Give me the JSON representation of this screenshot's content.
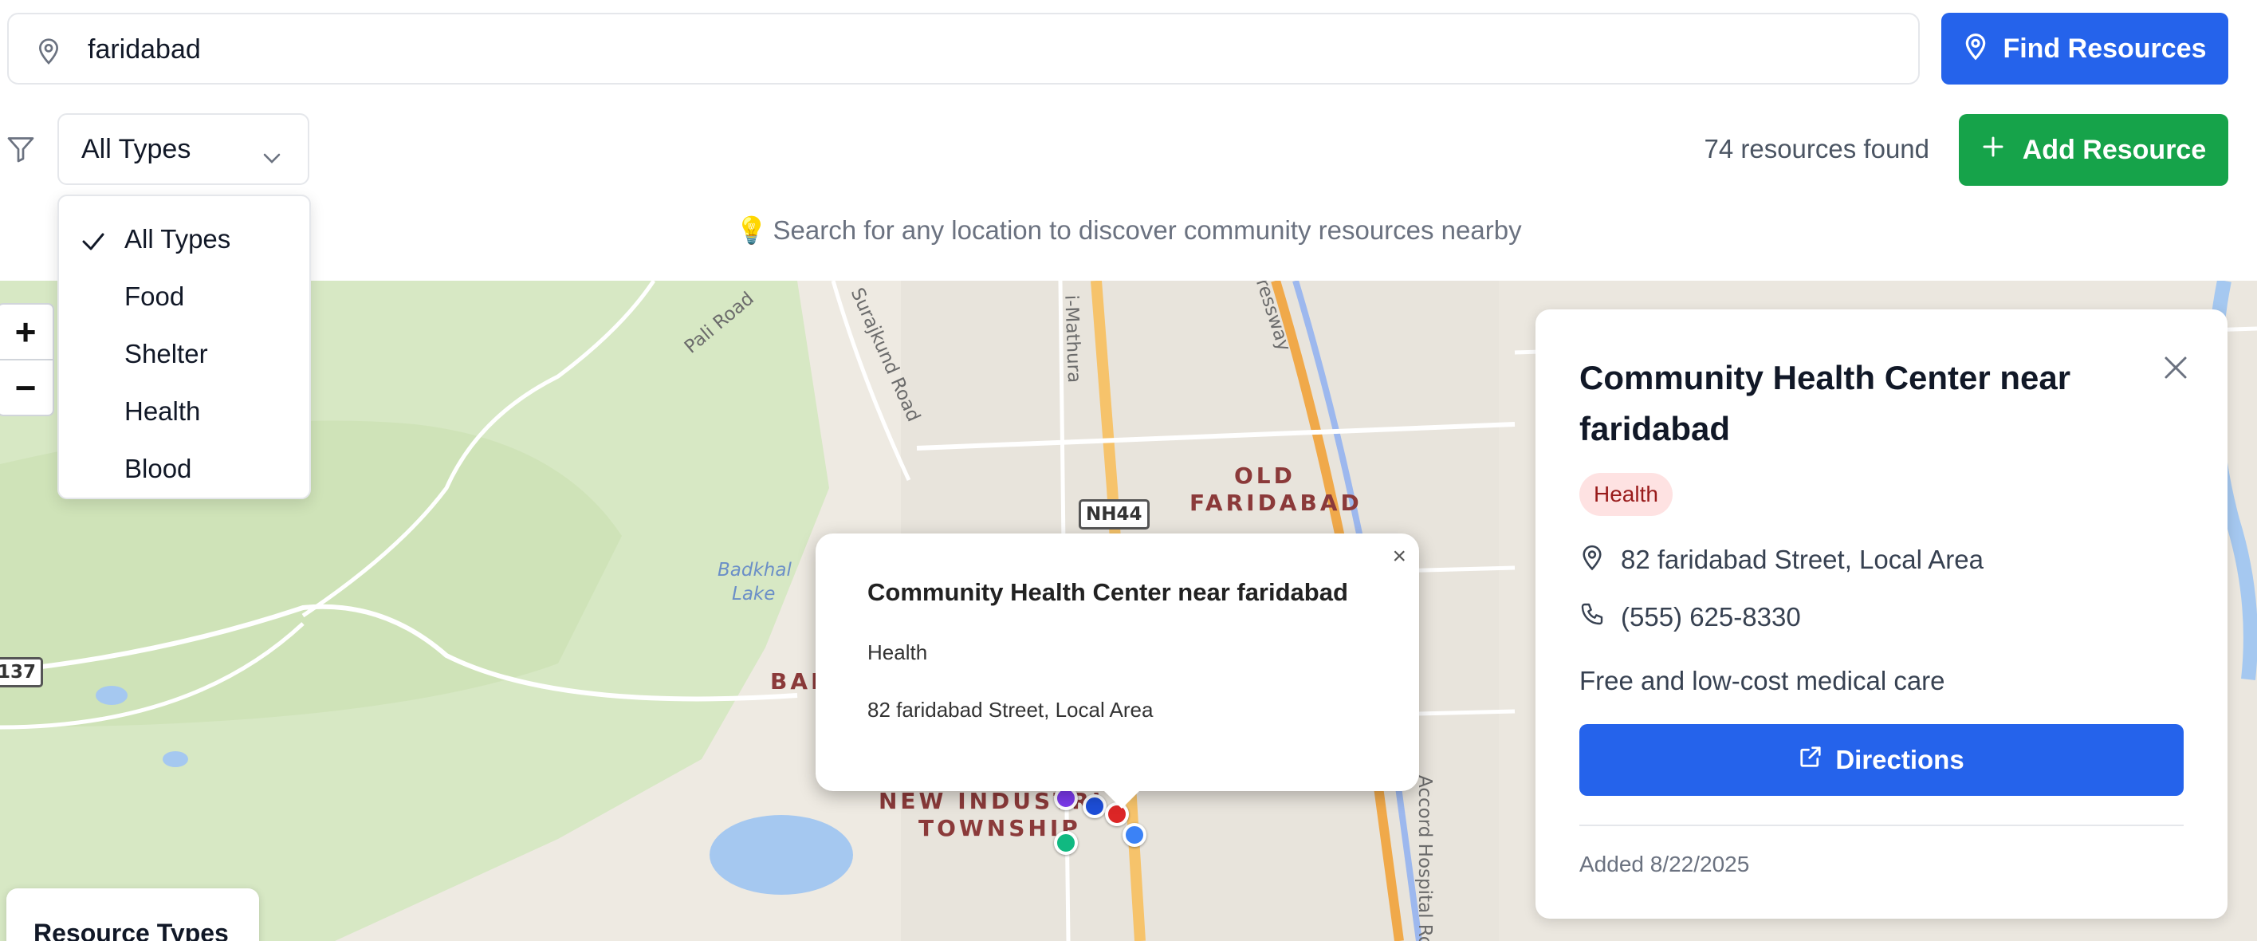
{
  "search": {
    "value": "faridabad",
    "find_label": "Find Resources"
  },
  "filter": {
    "selected": "All Types",
    "options": [
      "All Types",
      "Food",
      "Shelter",
      "Health",
      "Blood"
    ]
  },
  "results": {
    "count_text": "74 resources found",
    "add_label": "Add Resource"
  },
  "hint": "Search for any location to discover community resources nearby",
  "map": {
    "zoom_in": "+",
    "zoom_out": "−",
    "places": [
      "OLD",
      "FARIDABAD",
      "BAD",
      "NEW INDUSTRI",
      "TOWNSHIP"
    ],
    "roads": [
      "Pali Road",
      "Surajkund Road",
      "i-Mathura",
      "ressway",
      "Badkhal",
      "Lake",
      "Accord Hospital Road"
    ],
    "shields": [
      "NH44",
      "137"
    ],
    "popup": {
      "title": "Community Health Center near faridabad",
      "type": "Health",
      "address": "82 faridabad Street, Local Area",
      "close": "×"
    },
    "marker_colors": [
      "#7c3aed",
      "#1d4ed8",
      "#dc2626",
      "#3b82f6",
      "#10b981"
    ],
    "legend_title": "Resource Types"
  },
  "detail": {
    "title": "Community Health Center near faridabad",
    "badge": "Health",
    "address": "82 faridabad Street, Local Area",
    "phone": "(555) 625-8330",
    "description": "Free and low-cost medical care",
    "directions_label": "Directions",
    "added": "Added 8/22/2025"
  },
  "colors": {
    "primary": "#2563eb",
    "success": "#16a34a",
    "health_badge_bg": "#fee2e2",
    "health_badge_text": "#991b1b"
  }
}
